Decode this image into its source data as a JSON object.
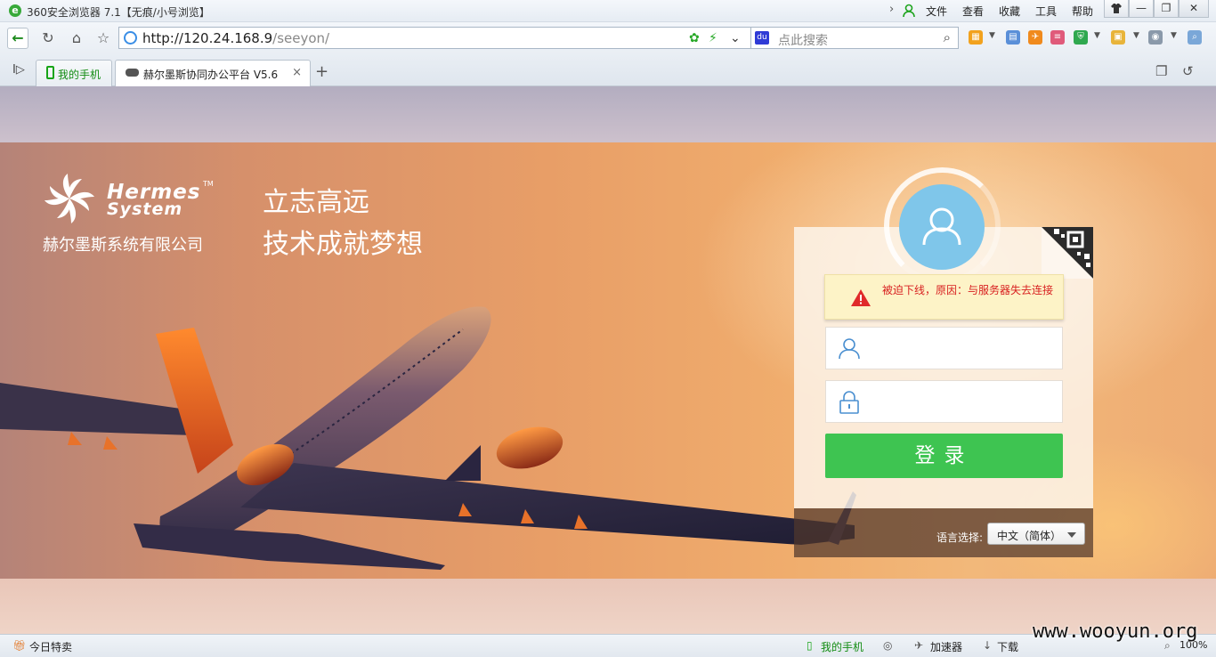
{
  "browser": {
    "title": "360安全浏览器 7.1【无痕/小号浏览】",
    "menu": [
      "文件",
      "查看",
      "收藏",
      "工具",
      "帮助"
    ],
    "url_host": "http://120.24.168.9",
    "url_path": "/seeyon/",
    "search_placeholder": "点此搜索",
    "tabs": [
      {
        "label": "我的手机",
        "active": false
      },
      {
        "label": "赫尔墨斯协同办公平台 V5.6",
        "active": true
      }
    ]
  },
  "page": {
    "brand_line1": "Hermes",
    "brand_line2": "System",
    "trademark": "TM",
    "company": "赫尔墨斯系统有限公司",
    "slogan_line1": "立志高远",
    "slogan_line2": "技术成就梦想",
    "login": {
      "warning": "被迫下线，原因：与服务器失去连接",
      "username_value": "",
      "password_value": "",
      "submit_label": "登录",
      "language_label": "语言选择:",
      "language_value": "中文（简体）"
    }
  },
  "statusbar": {
    "today_deals": "今日特卖",
    "my_phone": "我的手机",
    "accelerator": "加速器",
    "download": "下载",
    "zoom": "100%",
    "watermark": "www.wooyun.org"
  },
  "colors": {
    "login_button": "#3ec451",
    "avatar": "#7fc6ea",
    "warning_text": "#d82020",
    "warning_bg": "#fdf3c7"
  }
}
